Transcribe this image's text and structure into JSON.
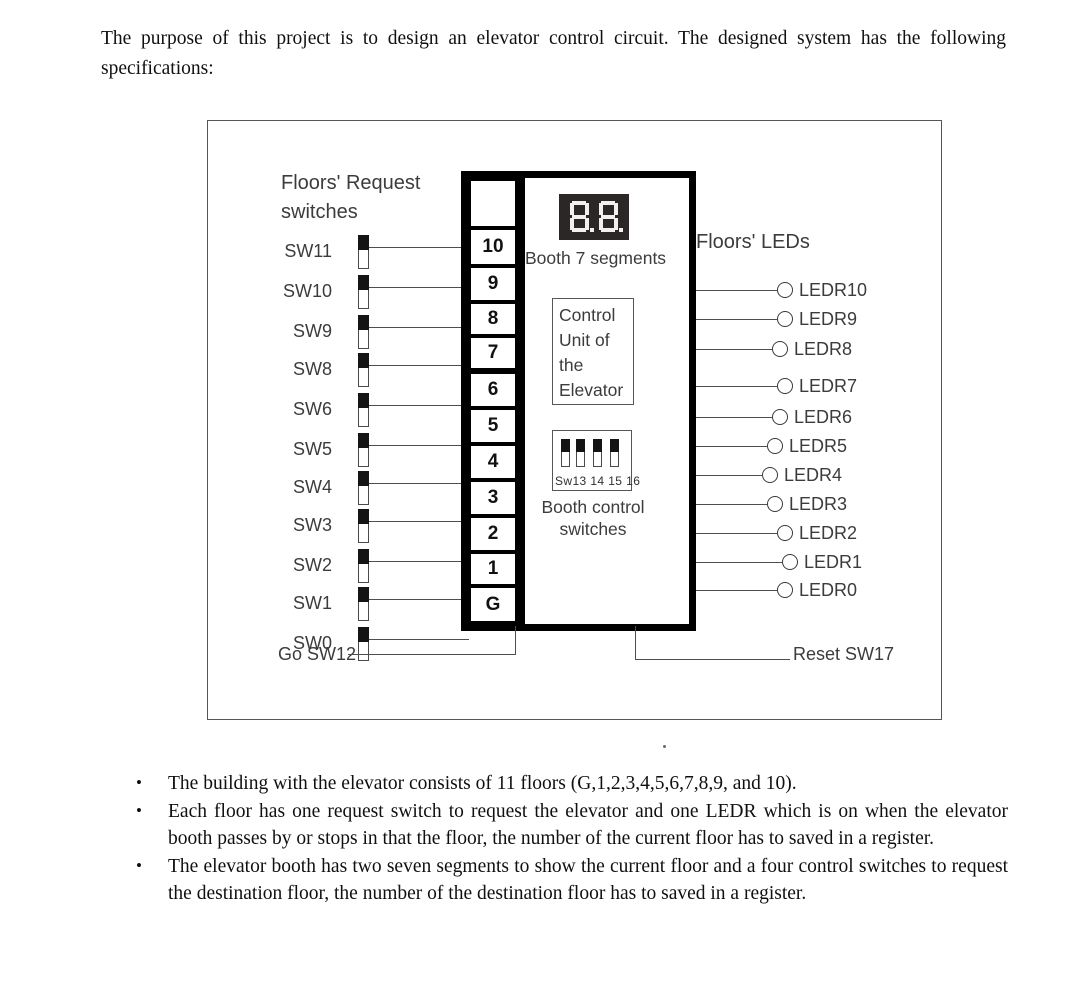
{
  "intro": "The purpose of this project is to design an elevator control circuit. The designed system has the following specifications:",
  "diagram": {
    "floors_request_title": "Floors' Request switches",
    "floors_leds_title": "Floors' LEDs",
    "booth_seven_segments_label": "Booth 7 segments",
    "seven_segment_value": "8.8.",
    "control_unit_text": "Control Unit of the Elevator",
    "control_unit_lines": [
      "Control",
      "Unit  of",
      "the",
      "Elevator"
    ],
    "booth_control_switch_names": "Sw13 14 15 16",
    "booth_control_caption": "Booth control switches",
    "booth_control_switches": [
      "Sw13",
      "14",
      "15",
      "16"
    ],
    "go_label": "Go SW12",
    "reset_label": "Reset SW17",
    "switch_rows": [
      {
        "switch": "SW11",
        "floor": "10"
      },
      {
        "switch": "SW10",
        "floor": "9"
      },
      {
        "switch": "SW9",
        "floor": "8"
      },
      {
        "switch": "SW8",
        "floor": "7"
      },
      {
        "switch": "SW6",
        "floor": "6"
      },
      {
        "switch": "SW5",
        "floor": "5"
      },
      {
        "switch": "SW4",
        "floor": "4"
      },
      {
        "switch": "SW3",
        "floor": "3"
      },
      {
        "switch": "SW2",
        "floor": "2"
      },
      {
        "switch": "SW1",
        "floor": "1"
      },
      {
        "switch": "SW0",
        "floor": "G"
      }
    ],
    "leds": [
      "LEDR10",
      "LEDR9",
      "LEDR8",
      "LEDR7",
      "LEDR6",
      "LEDR5",
      "LEDR4",
      "LEDR3",
      "LEDR2",
      "LEDR1",
      "LEDR0"
    ],
    "colors": {
      "device_border": "#000000",
      "seven_segment_background": "#2b2726",
      "seven_segment_on": "#f2f0ee",
      "switch_lever": "#141414",
      "wire": "#4e4e4e",
      "frame": "#555555",
      "label_text": "#3c3c3c"
    }
  },
  "bullets": [
    "The building with the elevator consists of 11 floors (G,1,2,3,4,5,6,7,8,9, and 10).",
    "Each floor has one request switch to request the elevator and one LEDR which is on when the elevator booth passes by or stops in that the floor, the number of the current floor has to saved in a register.",
    "The elevator booth has two seven segments to show the current floor and a four   control switches to request the destination floor, the number of the destination floor has to saved in a register."
  ]
}
